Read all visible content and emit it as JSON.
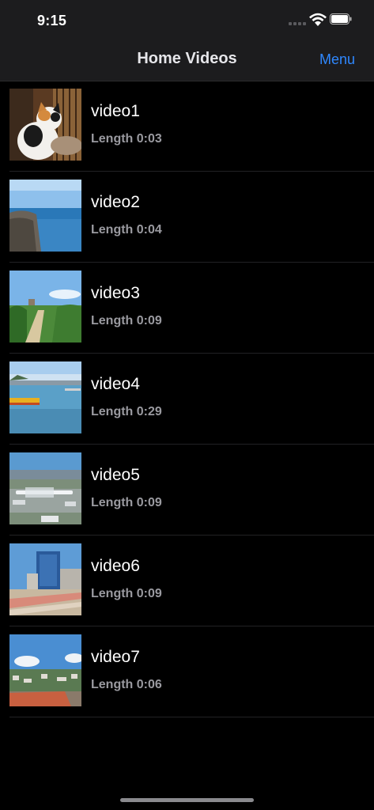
{
  "status_bar": {
    "time": "9:15"
  },
  "nav": {
    "title": "Home Videos",
    "menu_label": "Menu"
  },
  "videos": [
    {
      "title": "video1",
      "length": "Length 0:03",
      "thumbnail": "cat-photo"
    },
    {
      "title": "video2",
      "length": "Length 0:04",
      "thumbnail": "ocean-cliff-photo"
    },
    {
      "title": "video3",
      "length": "Length 0:09",
      "thumbnail": "grass-path-photo"
    },
    {
      "title": "video4",
      "length": "Length 0:29",
      "thumbnail": "beach-boat-photo"
    },
    {
      "title": "video5",
      "length": "Length 0:09",
      "thumbnail": "airport-photo"
    },
    {
      "title": "video6",
      "length": "Length 0:09",
      "thumbnail": "building-photo"
    },
    {
      "title": "video7",
      "length": "Length 0:06",
      "thumbnail": "city-view-photo"
    }
  ],
  "colors": {
    "background": "#000000",
    "bar": "#1c1c1e",
    "accent": "#2f88ff",
    "secondary_text": "#9a9aa0"
  }
}
